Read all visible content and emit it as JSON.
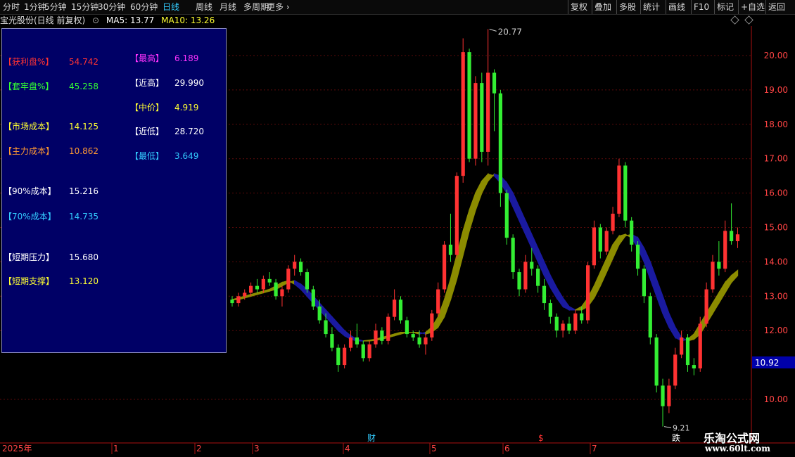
{
  "toolbar": {
    "left": [
      "分时",
      "1分钟",
      "5分钟",
      "15分钟",
      "30分钟",
      "60分钟",
      "日线",
      "周线",
      "月线",
      "多周期",
      "更多"
    ],
    "active": "日线",
    "right": [
      "复权",
      "叠加",
      "多股",
      "统计",
      "画线",
      "F10",
      "标记",
      "+自选",
      "返回"
    ]
  },
  "info": {
    "stock": "宝光股份(日线 前复权)",
    "ma5": "MA5: 13.77",
    "ma10": "MA10: 13.26"
  },
  "panel": {
    "left": [
      {
        "label": "【获利盘%】",
        "value": "54.742",
        "color": "#ff3333"
      },
      {
        "label": "【套牢盘%】",
        "value": "45.258",
        "color": "#33ff33"
      },
      {
        "label": "【市场成本】",
        "value": "14.125",
        "color": "#ffff33"
      },
      {
        "label": "【主力成本】",
        "value": "10.862",
        "color": "#ff9933"
      },
      {
        "label": "【90%成本】",
        "value": "15.216",
        "color": "#ffffff"
      },
      {
        "label": "【70%成本】",
        "value": "14.735",
        "color": "#33ccff"
      },
      {
        "label": "【短期压力】",
        "value": "15.680",
        "color": "#ffffff"
      },
      {
        "label": "【短期支撑】",
        "value": "13.120",
        "color": "#ffff33"
      }
    ],
    "right": [
      {
        "label": "【最高】",
        "value": "6.189",
        "color": "#ff33ff"
      },
      {
        "label": "【近高】",
        "value": "29.990",
        "color": "#ffffff"
      },
      {
        "label": "【中价】",
        "value": "4.919",
        "color": "#ffff33"
      },
      {
        "label": "【近低】",
        "value": "28.720",
        "color": "#ffffff"
      },
      {
        "label": "【最低】",
        "value": "3.649",
        "color": "#33ccff"
      }
    ]
  },
  "axis": {
    "prices": [
      "20.00",
      "19.00",
      "18.00",
      "17.00",
      "16.00",
      "15.00",
      "14.00",
      "13.00",
      "12.00",
      "10.00"
    ],
    "current": "10.92",
    "high_label": "20.77",
    "low_label": "9.21"
  },
  "timeline": {
    "year": "2025年",
    "months": [
      "1",
      "2",
      "3",
      "4",
      "5",
      "6",
      "7"
    ],
    "markers": [
      {
        "text": "财",
        "color": "#33ccff"
      },
      {
        "text": "$",
        "color": "#ff3333"
      },
      {
        "text": "跌",
        "color": "#ffffff"
      }
    ]
  },
  "watermark": {
    "name": "乐淘公式网",
    "url": "www.60lt.com"
  },
  "chart_data": {
    "type": "candlestick",
    "y_range": [
      9.0,
      21.0
    ],
    "ohlc": [
      [
        12.9,
        13.0,
        12.7,
        12.8
      ],
      [
        12.8,
        13.1,
        12.7,
        13.0
      ],
      [
        13.0,
        13.2,
        12.9,
        13.1
      ],
      [
        13.1,
        13.4,
        13.0,
        13.3
      ],
      [
        13.3,
        13.5,
        13.1,
        13.2
      ],
      [
        13.2,
        13.6,
        13.1,
        13.5
      ],
      [
        13.5,
        13.7,
        13.3,
        13.4
      ],
      [
        13.4,
        13.5,
        12.9,
        13.0
      ],
      [
        13.0,
        13.3,
        12.7,
        13.2
      ],
      [
        13.2,
        13.9,
        13.1,
        13.8
      ],
      [
        13.8,
        14.2,
        13.6,
        14.0
      ],
      [
        14.0,
        14.1,
        13.6,
        13.7
      ],
      [
        13.7,
        13.8,
        13.1,
        13.2
      ],
      [
        13.2,
        13.3,
        12.6,
        12.7
      ],
      [
        12.7,
        12.9,
        12.2,
        12.3
      ],
      [
        12.3,
        12.5,
        11.8,
        11.9
      ],
      [
        11.9,
        12.1,
        11.4,
        11.5
      ],
      [
        11.5,
        11.6,
        10.8,
        11.0
      ],
      [
        11.0,
        11.6,
        10.9,
        11.5
      ],
      [
        11.5,
        12.0,
        11.4,
        11.8
      ],
      [
        11.8,
        12.2,
        11.5,
        11.6
      ],
      [
        11.6,
        11.7,
        11.1,
        11.2
      ],
      [
        11.2,
        11.7,
        11.1,
        11.6
      ],
      [
        11.6,
        12.2,
        11.5,
        12.0
      ],
      [
        12.0,
        12.1,
        11.6,
        11.7
      ],
      [
        11.7,
        12.5,
        11.6,
        12.4
      ],
      [
        12.4,
        13.2,
        12.3,
        12.9
      ],
      [
        12.9,
        13.0,
        12.2,
        12.3
      ],
      [
        12.3,
        12.4,
        11.8,
        11.9
      ],
      [
        11.9,
        12.0,
        11.7,
        11.8
      ],
      [
        11.8,
        12.0,
        11.5,
        11.6
      ],
      [
        11.6,
        11.9,
        11.3,
        11.8
      ],
      [
        11.8,
        12.6,
        11.7,
        12.5
      ],
      [
        12.5,
        13.4,
        12.4,
        13.2
      ],
      [
        13.2,
        14.6,
        13.1,
        14.5
      ],
      [
        14.5,
        15.4,
        14.0,
        14.2
      ],
      [
        14.2,
        16.6,
        14.1,
        16.5
      ],
      [
        16.5,
        20.5,
        16.3,
        20.1
      ],
      [
        20.1,
        20.2,
        16.9,
        17.0
      ],
      [
        17.0,
        19.4,
        16.8,
        19.2
      ],
      [
        19.2,
        19.5,
        16.9,
        17.2
      ],
      [
        17.2,
        20.77,
        16.8,
        19.5
      ],
      [
        19.5,
        19.6,
        17.8,
        18.9
      ],
      [
        18.9,
        19.0,
        15.6,
        16.0
      ],
      [
        16.0,
        16.1,
        14.5,
        14.7
      ],
      [
        14.7,
        14.8,
        13.5,
        13.7
      ],
      [
        13.7,
        13.8,
        13.0,
        13.2
      ],
      [
        13.2,
        14.2,
        13.1,
        14.0
      ],
      [
        14.0,
        14.4,
        13.6,
        13.8
      ],
      [
        13.8,
        13.9,
        13.1,
        13.3
      ],
      [
        13.3,
        13.5,
        12.6,
        12.8
      ],
      [
        12.8,
        12.9,
        12.2,
        12.4
      ],
      [
        12.4,
        12.5,
        11.8,
        12.0
      ],
      [
        12.0,
        12.3,
        11.8,
        12.2
      ],
      [
        12.2,
        12.4,
        11.9,
        12.0
      ],
      [
        12.0,
        12.6,
        11.9,
        12.5
      ],
      [
        12.5,
        12.7,
        12.2,
        12.3
      ],
      [
        12.3,
        14.0,
        12.2,
        13.9
      ],
      [
        13.9,
        15.2,
        13.8,
        15.0
      ],
      [
        15.0,
        15.1,
        14.1,
        14.3
      ],
      [
        14.3,
        15.0,
        14.2,
        14.9
      ],
      [
        14.9,
        15.6,
        14.8,
        15.4
      ],
      [
        15.4,
        17.0,
        15.3,
        16.8
      ],
      [
        16.8,
        16.9,
        15.0,
        15.2
      ],
      [
        15.2,
        15.3,
        14.3,
        14.5
      ],
      [
        14.5,
        14.6,
        13.6,
        13.8
      ],
      [
        13.8,
        13.9,
        12.8,
        13.0
      ],
      [
        13.0,
        13.1,
        11.6,
        11.8
      ],
      [
        11.8,
        11.9,
        10.2,
        10.4
      ],
      [
        10.4,
        10.6,
        9.21,
        9.8
      ],
      [
        9.8,
        10.6,
        9.6,
        10.4
      ],
      [
        10.4,
        11.5,
        10.3,
        11.3
      ],
      [
        11.3,
        12.0,
        11.2,
        11.8
      ],
      [
        11.8,
        11.9,
        10.8,
        11.0
      ],
      [
        11.0,
        11.2,
        10.7,
        10.9
      ],
      [
        10.9,
        12.4,
        10.8,
        12.2
      ],
      [
        12.2,
        13.4,
        12.1,
        13.2
      ],
      [
        13.2,
        14.2,
        13.1,
        14.0
      ],
      [
        14.0,
        14.6,
        13.6,
        13.8
      ],
      [
        13.8,
        15.2,
        13.7,
        14.9
      ],
      [
        14.9,
        15.7,
        14.5,
        14.6
      ],
      [
        14.6,
        15.0,
        14.4,
        14.8
      ]
    ],
    "ma_band": [
      [
        12.9,
        12.9
      ],
      [
        12.9,
        12.95
      ],
      [
        12.95,
        13.0
      ],
      [
        13.0,
        13.05
      ],
      [
        13.05,
        13.1
      ],
      [
        13.1,
        13.15
      ],
      [
        13.15,
        13.2
      ],
      [
        13.2,
        13.3
      ],
      [
        13.3,
        13.4
      ],
      [
        13.4,
        13.45
      ],
      [
        13.45,
        13.35
      ],
      [
        13.35,
        13.2
      ],
      [
        13.2,
        13.0
      ],
      [
        13.0,
        12.8
      ],
      [
        12.8,
        12.6
      ],
      [
        12.6,
        12.4
      ],
      [
        12.4,
        12.2
      ],
      [
        12.2,
        12.0
      ],
      [
        12.0,
        11.85
      ],
      [
        11.85,
        11.75
      ],
      [
        11.75,
        11.7
      ],
      [
        11.7,
        11.7
      ],
      [
        11.7,
        11.72
      ],
      [
        11.72,
        11.75
      ],
      [
        11.75,
        11.8
      ],
      [
        11.8,
        11.85
      ],
      [
        11.85,
        11.9
      ],
      [
        11.9,
        11.95
      ],
      [
        11.95,
        11.95
      ],
      [
        11.95,
        11.95
      ],
      [
        11.95,
        11.9
      ],
      [
        11.9,
        11.95
      ],
      [
        11.95,
        12.1
      ],
      [
        12.1,
        12.4
      ],
      [
        12.4,
        12.9
      ],
      [
        12.9,
        13.5
      ],
      [
        13.5,
        14.2
      ],
      [
        14.2,
        14.9
      ],
      [
        14.9,
        15.5
      ],
      [
        15.5,
        16.0
      ],
      [
        16.0,
        16.35
      ],
      [
        16.35,
        16.55
      ],
      [
        16.55,
        16.5
      ],
      [
        16.5,
        16.3
      ],
      [
        16.3,
        16.0
      ],
      [
        16.0,
        15.6
      ],
      [
        15.6,
        15.2
      ],
      [
        15.2,
        14.8
      ],
      [
        14.8,
        14.4
      ],
      [
        14.4,
        14.0
      ],
      [
        14.0,
        13.6
      ],
      [
        13.6,
        13.25
      ],
      [
        13.25,
        12.95
      ],
      [
        12.95,
        12.7
      ],
      [
        12.7,
        12.6
      ],
      [
        12.6,
        12.6
      ],
      [
        12.6,
        12.7
      ],
      [
        12.7,
        12.95
      ],
      [
        12.95,
        13.3
      ],
      [
        13.3,
        13.7
      ],
      [
        13.7,
        14.1
      ],
      [
        14.1,
        14.5
      ],
      [
        14.5,
        14.75
      ],
      [
        14.75,
        14.8
      ],
      [
        14.8,
        14.7
      ],
      [
        14.7,
        14.4
      ],
      [
        14.4,
        14.0
      ],
      [
        14.0,
        13.5
      ],
      [
        13.5,
        13.0
      ],
      [
        13.0,
        12.5
      ],
      [
        12.5,
        12.1
      ],
      [
        12.1,
        11.8
      ],
      [
        11.8,
        11.7
      ],
      [
        11.7,
        11.75
      ],
      [
        11.75,
        11.9
      ],
      [
        11.9,
        12.2
      ],
      [
        12.2,
        12.5
      ],
      [
        12.5,
        12.8
      ],
      [
        12.8,
        13.1
      ],
      [
        13.1,
        13.4
      ],
      [
        13.4,
        13.6
      ],
      [
        13.6,
        13.75
      ]
    ]
  }
}
